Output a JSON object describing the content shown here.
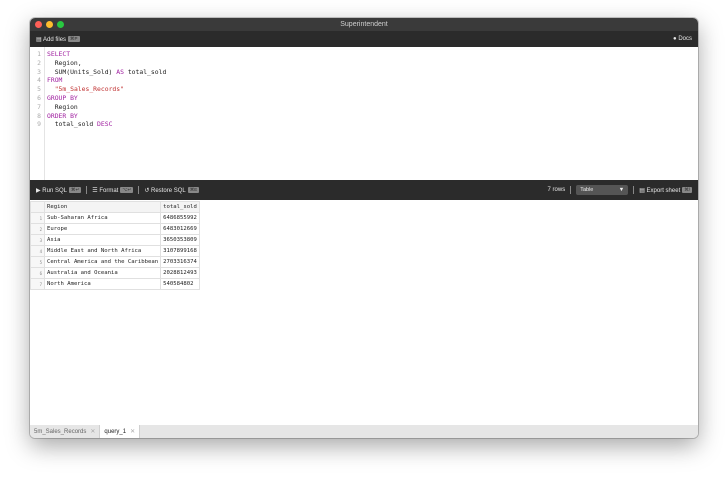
{
  "window": {
    "title": "Superintendent"
  },
  "toolbar": {
    "add_files": "Add files",
    "add_files_kbd": "⌘P",
    "docs": "Docs"
  },
  "editor": {
    "lines": [
      "1",
      "2",
      "3",
      "4",
      "5",
      "6",
      "7",
      "8",
      "9"
    ]
  },
  "runbar": {
    "run_sql": "Run SQL",
    "run_kbd": "⌘↵",
    "format": "Format",
    "format_kbd": "⌥↵",
    "restore": "Restore SQL",
    "restore_kbd": "⌘E",
    "row_count": "7 rows",
    "view": "Table",
    "export": "Export sheet",
    "export_kbd": "⌘/"
  },
  "results": {
    "columns": [
      "Region",
      "total_sold"
    ],
    "rows": [
      [
        "1",
        "Sub-Saharan Africa",
        "6486855992"
      ],
      [
        "2",
        "Europe",
        "6483012669"
      ],
      [
        "3",
        "Asia",
        "3650353809"
      ],
      [
        "4",
        "Middle East and North Africa",
        "3107899168"
      ],
      [
        "5",
        "Central America and the Caribbean",
        "2703316374"
      ],
      [
        "6",
        "Australia and Oceania",
        "2028812493"
      ],
      [
        "7",
        "North America",
        "540584802"
      ]
    ]
  },
  "tabs": [
    {
      "label": "5m_Sales_Records"
    },
    {
      "label": "query_1"
    }
  ],
  "colors": {
    "keyword": "#a020a0",
    "string": "#c03030"
  }
}
